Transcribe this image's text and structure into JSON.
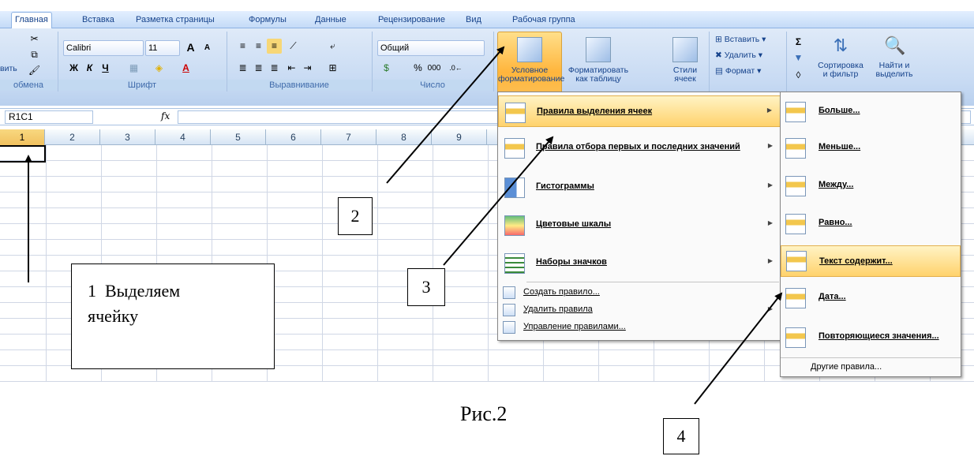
{
  "tabs": [
    "Главная",
    "Вставка",
    "Разметка страницы",
    "Формулы",
    "Данные",
    "Рецензирование",
    "Вид",
    "Рабочая группа"
  ],
  "ribbon": {
    "clipboard": {
      "caption": "обмена",
      "paste_label": "вить"
    },
    "font": {
      "caption": "Шрифт",
      "font_name": "Calibri",
      "font_size": "11",
      "grow_glyph": "A",
      "shrink_glyph": "A",
      "bold": "Ж",
      "italic": "К",
      "underline": "Ч",
      "font_color_glyph": "A"
    },
    "alignment": {
      "caption": "Выравнивание"
    },
    "number": {
      "caption": "Число",
      "format": "Общий",
      "percent": "%",
      "thousands": "000"
    },
    "styles": {
      "conditional_formatting": [
        "Условное",
        "форматирование"
      ],
      "format_as_table": [
        "Форматировать",
        "как таблицу"
      ],
      "cell_styles": [
        "Стили",
        "ячеек"
      ]
    },
    "cells": {
      "insert": "Вставить",
      "delete": "Удалить",
      "format": "Формат"
    },
    "editing": {
      "sigma": "Σ",
      "sort_filter": [
        "Сортировка",
        "и фильтр"
      ],
      "find_select": [
        "Найти и",
        "выделить"
      ]
    }
  },
  "formula_bar": {
    "name_box": "R1C1",
    "fx": "fx"
  },
  "columns": [
    "1",
    "2",
    "3",
    "4",
    "5",
    "6",
    "7",
    "8",
    "9"
  ],
  "cond_menu": {
    "items": [
      {
        "label": "Правила выделения ячеек",
        "submenu": true
      },
      {
        "label": "Правила отбора первых и последних значений",
        "submenu": true
      },
      {
        "label": "Гистограммы",
        "submenu": true
      },
      {
        "label": "Цветовые шкалы",
        "submenu": true
      },
      {
        "label": "Наборы значков",
        "submenu": true
      }
    ],
    "small_items": [
      {
        "label": "Создать правило...",
        "submenu": false
      },
      {
        "label": "Удалить правила",
        "submenu": true
      },
      {
        "label": "Управление правилами...",
        "submenu": false
      }
    ]
  },
  "sub_menu": {
    "items": [
      "Больше...",
      "Меньше...",
      "Между...",
      "Равно...",
      "Текст содержит...",
      "Дата...",
      "Повторяющиеся значения..."
    ],
    "footer": "Другие правила..."
  },
  "callouts": {
    "c1_number": "1",
    "c1_line1": "Выделяем",
    "c1_line2": "ячейку",
    "c2": "2",
    "c3": "3",
    "c4": "4"
  },
  "figure_caption": "Рис.2",
  "colors": {
    "accent": "#15428b",
    "highlight": "#ffd26c",
    "ribbon": "#c7daf3"
  }
}
